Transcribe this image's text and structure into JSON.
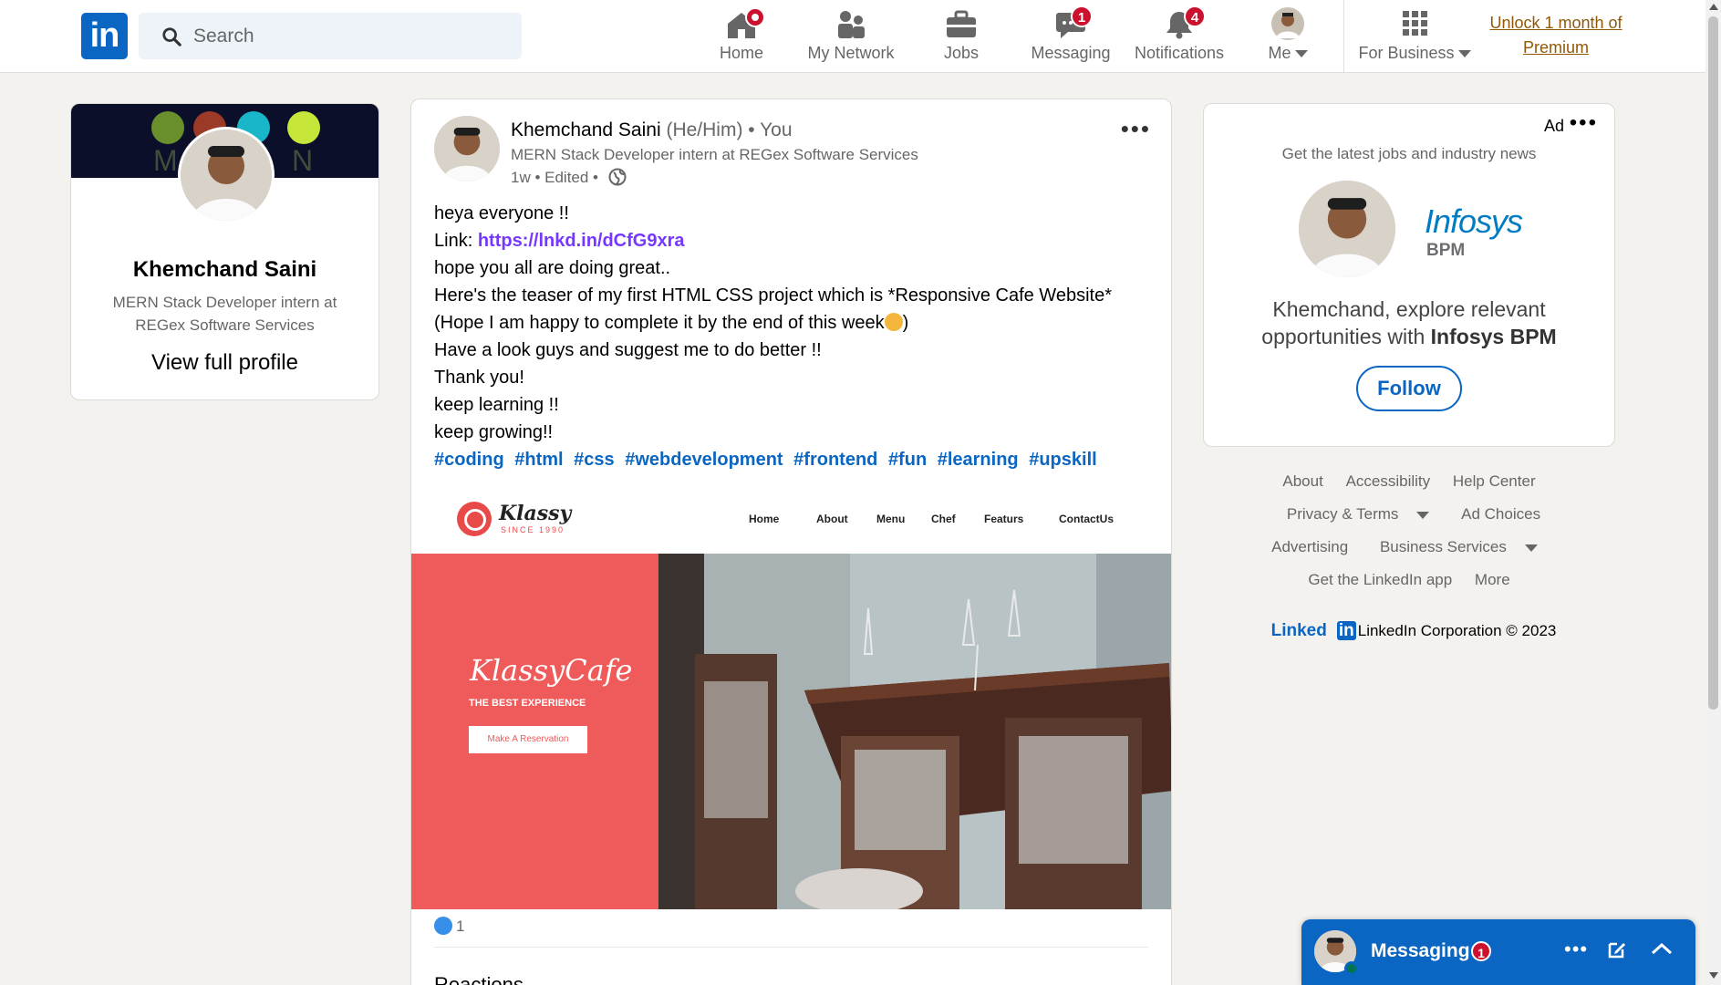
{
  "nav": {
    "logo": "in",
    "search_placeholder": "Search",
    "items": [
      {
        "label": "Home",
        "badge": ""
      },
      {
        "label": "My Network",
        "badge": ""
      },
      {
        "label": "Jobs",
        "badge": ""
      },
      {
        "label": "Messaging",
        "badge": "1"
      },
      {
        "label": "Notifications",
        "badge": "4"
      },
      {
        "label": "Me",
        "badge": ""
      },
      {
        "label": "For Business",
        "badge": ""
      }
    ],
    "premium_line1": "Unlock 1 month of",
    "premium_line2": "Premium"
  },
  "profile_card": {
    "cover_letters": [
      "M",
      "N"
    ],
    "name": "Khemchand Saini",
    "headline": "MERN Stack Developer intern at REGex Software Services",
    "view_profile": "View full profile"
  },
  "post": {
    "author": "Khemchand Saini",
    "pronouns": "(He/Him)",
    "you": "• You",
    "headline": "MERN Stack Developer intern at REGex Software Services",
    "meta": "1w • Edited •",
    "lines": {
      "l1": "heya everyone !!",
      "l2_prefix": "Link: ",
      "l2_link": "https://lnkd.in/dCfG9xra",
      "l3": "hope you all are doing great..",
      "l4": "Here's the teaser of my first HTML CSS project which is *Responsive Cafe Website*",
      "l5_a": "(Hope I am happy to complete it by the end of this week",
      "l5_b": ")",
      "l6": "Have a look guys and suggest me to do better !!",
      "l7": "Thank you!",
      "l8": "keep learning !!",
      "l9": "keep growing!!"
    },
    "hashtags": [
      "#coding",
      "#html",
      "#css",
      "#webdevelopment",
      "#frontend",
      "#fun",
      "#learning",
      "#upskill"
    ],
    "reaction_count": "1",
    "reactions_title": "Reactions"
  },
  "site_preview": {
    "brand": "Klassy",
    "since": "SINCE 1990",
    "menu": [
      "Home",
      "About",
      "Menu",
      "Chef",
      "Featurs",
      "ContactUs"
    ],
    "hero_title": "KlassyCafe",
    "hero_sub": "THE BEST EXPERIENCE",
    "hero_button": "Make A Reservation",
    "accent": "#ef5a5a"
  },
  "ad": {
    "label": "Ad",
    "subtitle": "Get the latest jobs and industry news",
    "company_name": "Infosys",
    "company_unit": "BPM",
    "text_prefix": "Khemchand, explore relevant opportunities with ",
    "text_company": "Infosys BPM",
    "follow": "Follow"
  },
  "footer": {
    "row1": [
      "About",
      "Accessibility",
      "Help Center"
    ],
    "row2": [
      "Privacy & Terms",
      "Ad Choices"
    ],
    "row3": [
      "Advertising",
      "Business Services"
    ],
    "row4": [
      "Get the LinkedIn app",
      "More"
    ],
    "brand_word": "Linked",
    "brand_in": "in",
    "copyright": "LinkedIn Corporation © 2023"
  },
  "messaging": {
    "title": "Messaging",
    "badge": "1"
  },
  "colors": {
    "brand": "#0a66c2",
    "badge": "#cb112d",
    "premium": "#915907",
    "link": "#7737ff"
  }
}
